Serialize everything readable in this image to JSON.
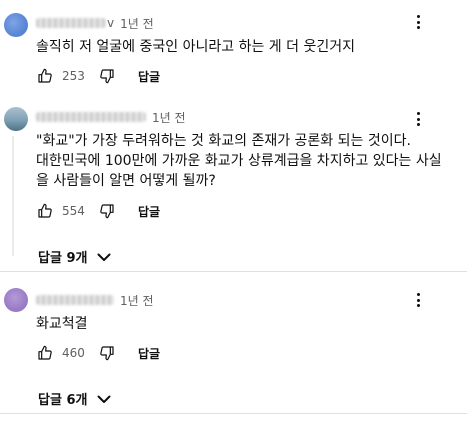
{
  "comments": [
    {
      "handle_suffix": "v",
      "time": "1년 전",
      "text": [
        "솔직히 저 얼굴에 중국인 아니라고 하는 게 더 웃긴거지"
      ],
      "likes": "253",
      "reply_label": "답글"
    },
    {
      "handle_suffix": "",
      "time": "1년 전",
      "text": [
        "\"화교\"가 가장 두려워하는 것 화교의 존재가 공론화 되는 것이다.",
        "대한민국에 100만에 가까운 화교가 상류계급을 차지하고 있다는 사실",
        "을 사람들이 알면 어떻게 될까?"
      ],
      "likes": "554",
      "reply_label": "답글",
      "replies_toggle": "답글 9개"
    },
    {
      "handle_suffix": "",
      "time": "1년 전",
      "text": [
        "화교척결"
      ],
      "likes": "460",
      "reply_label": "답글",
      "replies_toggle": "답글 6개"
    }
  ],
  "icons": {
    "like": "thumbs-up-icon",
    "dislike": "thumbs-down-icon",
    "more": "more-vertical-icon",
    "expand": "chevron-down-icon"
  },
  "colors": {
    "text": "#0f0f0f",
    "secondary": "#606060"
  }
}
